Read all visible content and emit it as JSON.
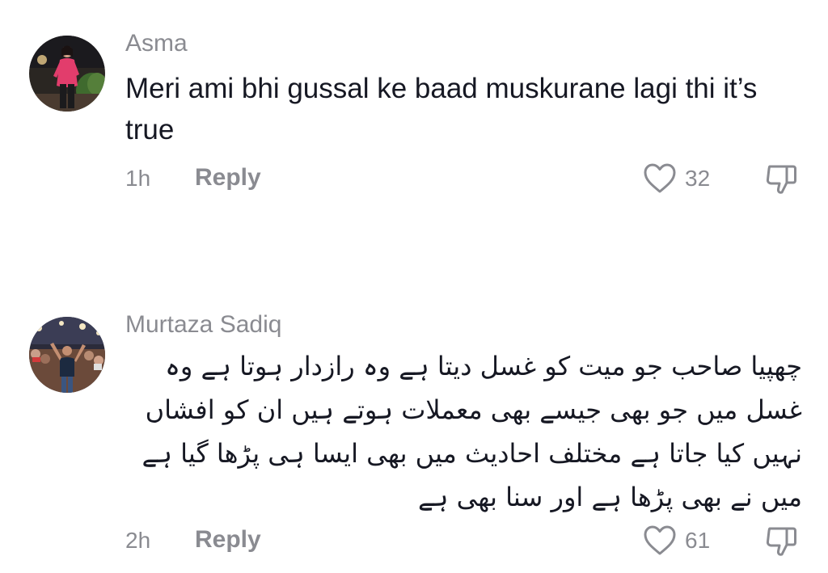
{
  "comments": [
    {
      "username": "Asma",
      "text": "Meri ami bhi gussal ke baad muskurane lagi thi it’s true",
      "time": "1h",
      "reply_label": "Reply",
      "likes": "32",
      "avatar_icon": "avatar-woman-pink",
      "like_icon": "heart-outline-icon",
      "dislike_icon": "thumbs-down-outline-icon"
    },
    {
      "username": "Murtaza Sadiq",
      "text": "چھپیا صاحب جو میت کو غسل دیتا ہے وہ رازدار ہوتا ہے وہ غسل میں جو بھی جیسے بھی معملات ہوتے ہیں ان کو افشاں نہیں کیا جاتا ہے مختلف احادیث میں بھی ایسا ہی پڑھا گیا ہے میں نے بھی پڑھا ہے اور سنا بھی ہے",
      "time": "2h",
      "reply_label": "Reply",
      "likes": "61",
      "avatar_icon": "avatar-man-crowd",
      "like_icon": "heart-outline-icon",
      "dislike_icon": "thumbs-down-outline-icon"
    }
  ],
  "colors": {
    "text": "#161823",
    "muted": "#8a8b91",
    "background": "#ffffff"
  }
}
